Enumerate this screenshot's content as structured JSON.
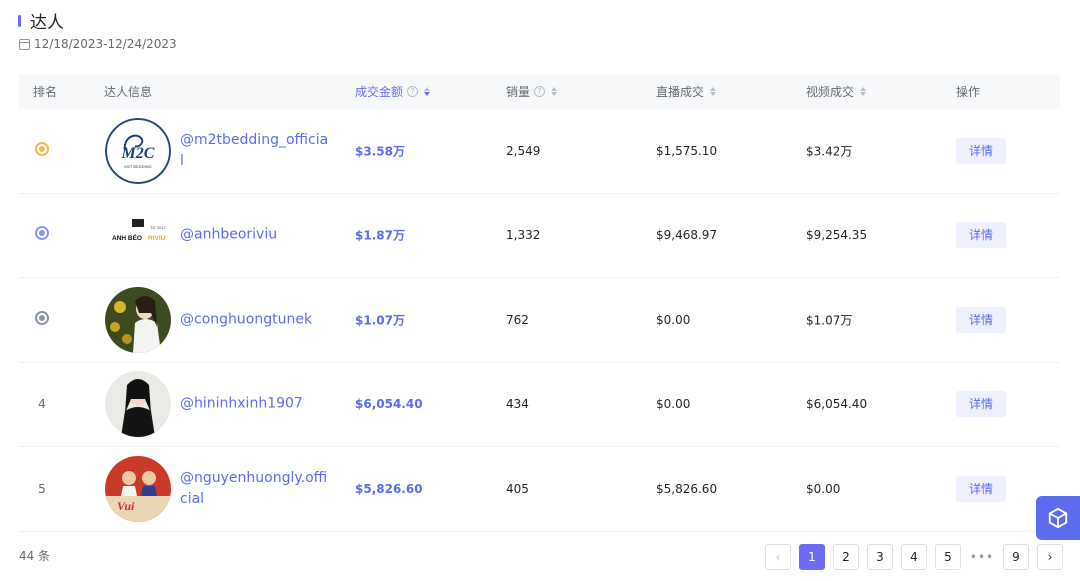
{
  "header": {
    "title": "达人",
    "date_range": "12/18/2023-12/24/2023"
  },
  "table": {
    "columns": {
      "rank": "排名",
      "info": "达人信息",
      "amount": "成交金额",
      "sales": "销量",
      "live": "直播成交",
      "video": "视频成交",
      "action": "操作"
    },
    "rows": [
      {
        "rank": "1",
        "medal": "gold-medal-icon",
        "handle": "@m2tbedding_official",
        "amount": "$3.58万",
        "sales": "2,549",
        "live": "$1,575.10",
        "video": "$3.42万",
        "button": "详情"
      },
      {
        "rank": "2",
        "medal": "silver-medal-icon",
        "handle": "@anhbeoriviu",
        "amount": "$1.87万",
        "sales": "1,332",
        "live": "$9,468.97",
        "video": "$9,254.35",
        "button": "详情"
      },
      {
        "rank": "3",
        "medal": "bronze-medal-icon",
        "handle": "@conghuongtunek",
        "amount": "$1.07万",
        "sales": "762",
        "live": "$0.00",
        "video": "$1.07万",
        "button": "详情"
      },
      {
        "rank": "4",
        "medal": "",
        "handle": "@hininhxinh1907",
        "amount": "$6,054.40",
        "sales": "434",
        "live": "$0.00",
        "video": "$6,054.40",
        "button": "详情"
      },
      {
        "rank": "5",
        "medal": "",
        "handle": "@nguyenhuongly.official",
        "amount": "$5,826.60",
        "sales": "405",
        "live": "$5,826.60",
        "video": "$0.00",
        "button": "详情"
      }
    ]
  },
  "footer": {
    "total": "44 条",
    "pages": [
      "1",
      "2",
      "3",
      "4",
      "5",
      "•••",
      "9"
    ],
    "current_page": "1"
  },
  "logo_text": {
    "m2t": "M2T BEDDING",
    "anhbeo_top": "TỪ 2017",
    "anhbeo_main": "ANH BÉO",
    "anhbeo_accent": "RIVIU"
  },
  "colors": {
    "accent": "#6b6cf6",
    "gold": "#f2b84b",
    "silver": "#8c95f0",
    "bronze": "#8a93a6"
  }
}
